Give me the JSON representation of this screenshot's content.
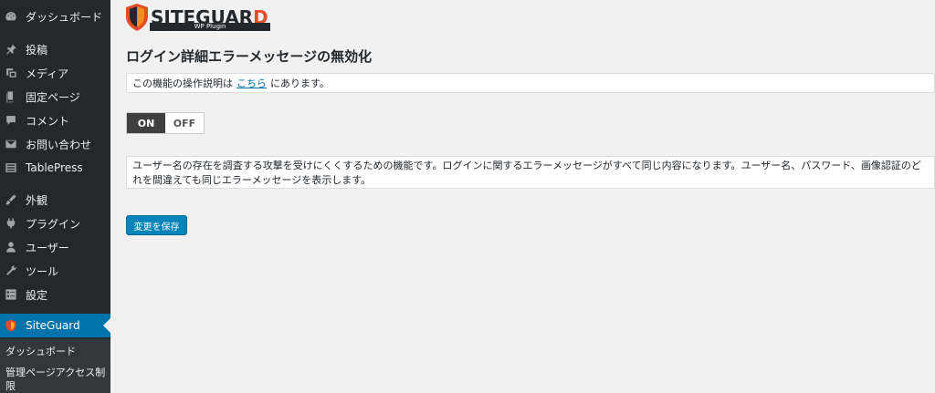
{
  "sidebar": {
    "items": [
      {
        "label": "ダッシュボード",
        "icon": "dashboard-icon"
      },
      {
        "label": "投稿",
        "icon": "pushpin-icon"
      },
      {
        "label": "メディア",
        "icon": "media-icon"
      },
      {
        "label": "固定ページ",
        "icon": "page-icon"
      },
      {
        "label": "コメント",
        "icon": "comment-icon"
      },
      {
        "label": "お問い合わせ",
        "icon": "mail-icon"
      },
      {
        "label": "TablePress",
        "icon": "table-icon"
      },
      {
        "label": "外観",
        "icon": "brush-icon"
      },
      {
        "label": "プラグイン",
        "icon": "plugin-icon"
      },
      {
        "label": "ユーザー",
        "icon": "user-icon"
      },
      {
        "label": "ツール",
        "icon": "wrench-icon"
      },
      {
        "label": "設定",
        "icon": "settings-icon"
      },
      {
        "label": "SiteGuard",
        "icon": "siteguard-icon"
      }
    ],
    "submenu": [
      "ダッシュボード",
      "管理ページアクセス制限"
    ]
  },
  "logo": {
    "text_main": "SITEGUAR",
    "text_accent": "D",
    "subtitle": "WP Plugin"
  },
  "page": {
    "title": "ログイン詳細エラーメッセージの無効化",
    "info_prefix": "この機能の操作説明は",
    "info_link": "こちら",
    "info_suffix": "にあります。",
    "toggle_on": "ON",
    "toggle_off": "OFF",
    "description": "ユーザー名の存在を調査する攻撃を受けにくくするための機能です。ログインに関するエラーメッセージがすべて同じ内容になります。ユーザー名、パスワード、画像認証のどれを間違えても同じエラーメッセージを表示します。",
    "save_label": "変更を保存"
  },
  "colors": {
    "sidebar_bg": "#23282d",
    "active": "#0073aa",
    "button": "#0085ba",
    "accent": "#e54d26"
  }
}
